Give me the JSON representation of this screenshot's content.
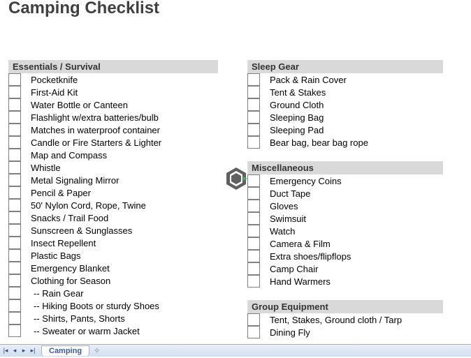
{
  "title": "Camping Checklist",
  "tabs": {
    "active": "Camping"
  },
  "sections": {
    "essentials": {
      "header": "Essentials / Survival",
      "items": [
        "Pocketknife",
        "First-Aid Kit",
        "Water Bottle or Canteen",
        "Flashlight w/extra batteries/bulb",
        "Matches in waterproof container",
        "Candle or Fire Starters & Lighter",
        "Map and Compass",
        "Whistle",
        "Metal Signaling Mirror",
        "Pencil & Paper",
        "50' Nylon Cord, Rope, Twine",
        "Snacks / Trail Food",
        "Sunscreen & Sunglasses",
        "Insect Repellent",
        "Plastic Bags",
        "Emergency Blanket",
        "Clothing for Season",
        " -- Rain Gear",
        " -- Hiking Boots or sturdy Shoes",
        " -- Shirts, Pants, Shorts",
        " -- Sweater or warm Jacket"
      ]
    },
    "sleep": {
      "header": "Sleep Gear",
      "items": [
        "Pack & Rain Cover",
        "Tent & Stakes",
        "Ground Cloth",
        "Sleeping Bag",
        "Sleeping Pad",
        "Bear bag, bear bag rope"
      ]
    },
    "misc": {
      "header": "Miscellaneous",
      "items": [
        "Emergency Coins",
        "Duct Tape",
        "Gloves",
        "Swimsuit",
        "Watch",
        "Camera & Film",
        "Extra shoes/flipflops",
        "Camp Chair",
        "Hand Warmers"
      ]
    },
    "group": {
      "header": "Group Equipment",
      "items": [
        "Tent, Stakes, Ground cloth / Tarp",
        "Dining Fly"
      ]
    }
  }
}
